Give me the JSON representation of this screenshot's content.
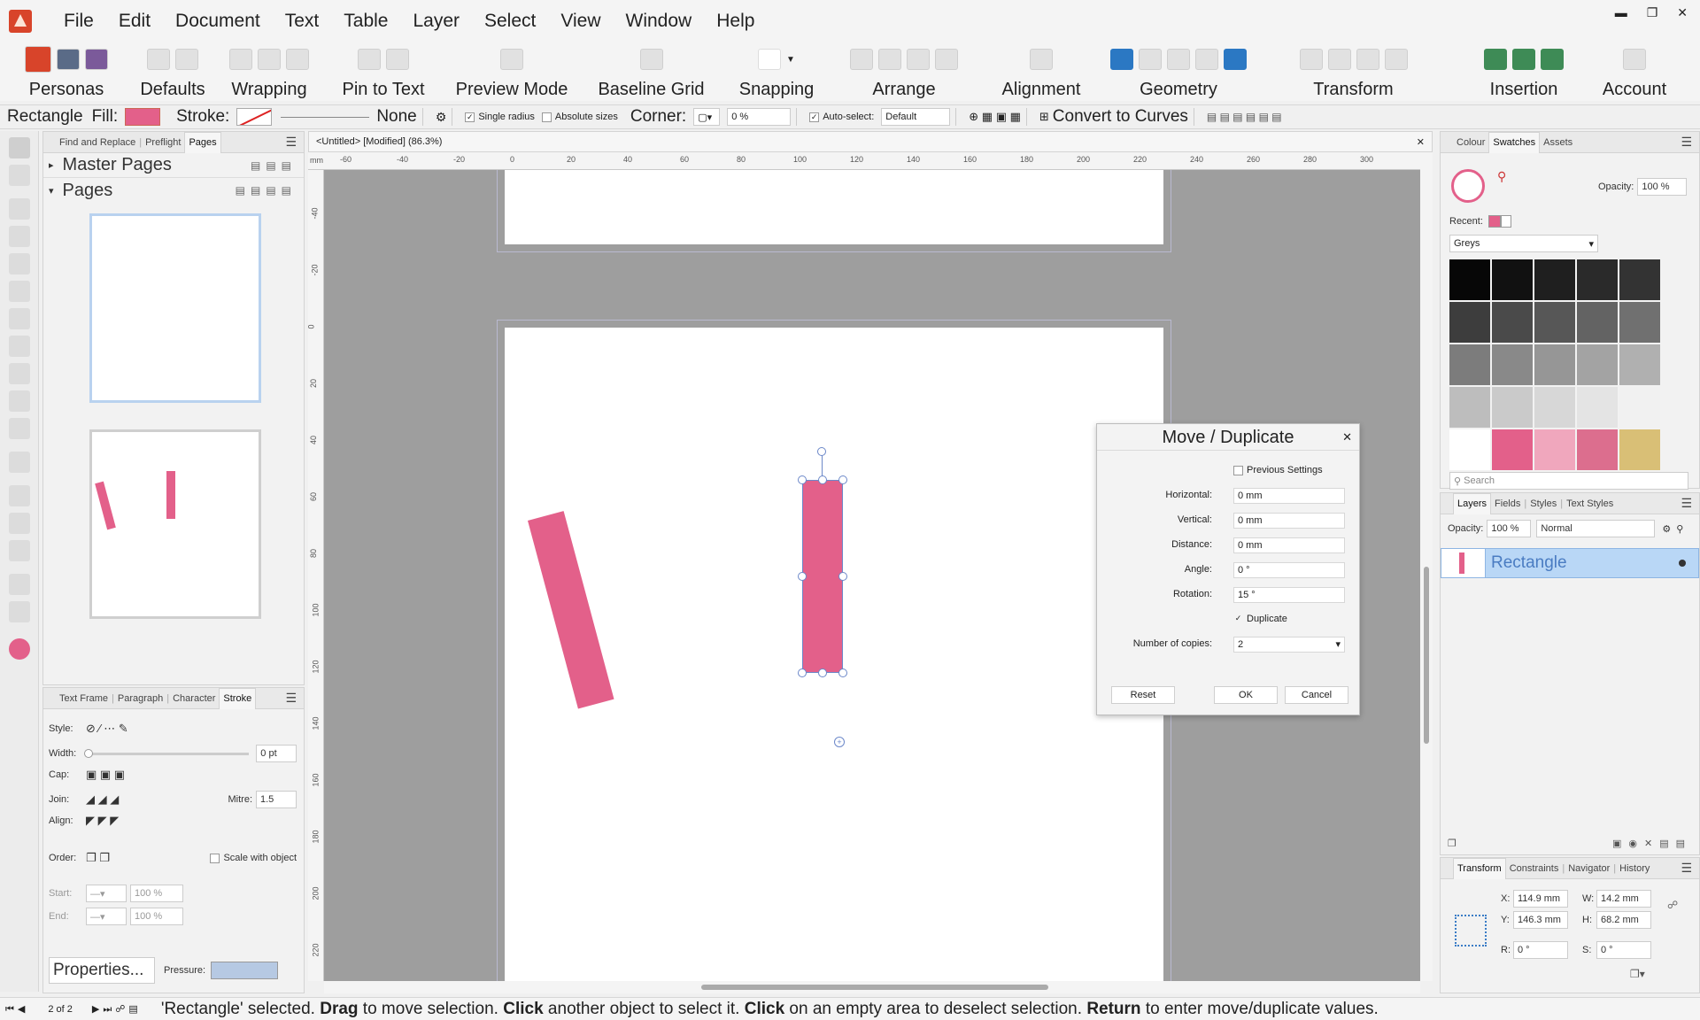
{
  "menubar": {
    "items": [
      "File",
      "Edit",
      "Document",
      "Text",
      "Table",
      "Layer",
      "Select",
      "View",
      "Window",
      "Help"
    ]
  },
  "toolbar": {
    "groups": [
      "Personas",
      "Defaults",
      "Wrapping",
      "Pin to Text",
      "Preview Mode",
      "Baseline Grid",
      "Snapping",
      "Arrange",
      "Alignment",
      "Geometry",
      "Transform",
      "Insertion",
      "Account"
    ]
  },
  "context": {
    "object": "Rectangle",
    "fill_label": "Fill:",
    "stroke_label": "Stroke:",
    "stroke_value": "None",
    "single_radius": "Single radius",
    "absolute_sizes": "Absolute sizes",
    "corner_label": "Corner:",
    "corner_value": "0 %",
    "auto_select_label": "Auto-select:",
    "auto_select_value": "Default",
    "convert": "Convert to Curves",
    "fill_color": "#e3608a"
  },
  "left_panel": {
    "tabs": [
      "Find and Replace",
      "Preflight",
      "Pages"
    ],
    "master_pages": "Master Pages",
    "pages": "Pages"
  },
  "stroke_panel": {
    "tabs": [
      "Text Frame",
      "Paragraph",
      "Character",
      "Stroke"
    ],
    "style": "Style:",
    "width": "Width:",
    "width_value": "0 pt",
    "cap": "Cap:",
    "join": "Join:",
    "mitre": "Mitre:",
    "mitre_value": "1.5",
    "align": "Align:",
    "order": "Order:",
    "scale": "Scale with object",
    "start": "Start:",
    "end": "End:",
    "pct": "100 %",
    "properties": "Properties...",
    "pressure": "Pressure:"
  },
  "document": {
    "tab_title": "<Untitled> [Modified] (86.3%)"
  },
  "ruler": {
    "h": [
      "-60",
      "-40",
      "-20",
      "0",
      "20",
      "40",
      "60",
      "80",
      "100",
      "120",
      "140",
      "160",
      "180",
      "200",
      "220",
      "240",
      "260",
      "280",
      "300"
    ],
    "v": [
      "-40",
      "-20",
      "0",
      "20",
      "40",
      "60",
      "80",
      "100",
      "120",
      "140",
      "160",
      "180",
      "200",
      "220"
    ],
    "unit": "mm"
  },
  "dialog": {
    "title": "Move / Duplicate",
    "previous": "Previous Settings",
    "horizontal_label": "Horizontal:",
    "horizontal": "0 mm",
    "vertical_label": "Vertical:",
    "vertical": "0 mm",
    "distance_label": "Distance:",
    "distance": "0 mm",
    "angle_label": "Angle:",
    "angle": "0 °",
    "rotation_label": "Rotation:",
    "rotation": "15 °",
    "duplicate": "Duplicate",
    "copies_label": "Number of copies:",
    "copies": "2",
    "reset": "Reset",
    "ok": "OK",
    "cancel": "Cancel"
  },
  "right_top": {
    "tabs": [
      "Colour",
      "Swatches",
      "Assets"
    ],
    "opacity_label": "Opacity:",
    "opacity": "100 %",
    "recent": "Recent:",
    "palette": "Greys",
    "search": "Search",
    "swatches": [
      "#070707",
      "#111111",
      "#1f1f1f",
      "#2a2a2a",
      "#333333",
      "#3d3d3d",
      "#4a4a4a",
      "#575757",
      "#636363",
      "#707070",
      "#7c7c7c",
      "#898989",
      "#969696",
      "#a3a3a3",
      "#b0b0b0",
      "#bdbdbd",
      "#cacaca",
      "#d7d7d7",
      "#e4e4e4",
      "#f1f1f1",
      "#ffffff",
      "#e3608a",
      "#f0a7bd",
      "#dc6e8e",
      "#d9bf76"
    ]
  },
  "layers": {
    "tabs": [
      "Layers",
      "Fields",
      "Styles",
      "Text Styles"
    ],
    "opacity_label": "Opacity:",
    "opacity": "100 %",
    "blend": "Normal",
    "item": "Rectangle"
  },
  "transform": {
    "tabs": [
      "Transform",
      "Constraints",
      "Navigator",
      "History"
    ],
    "x_label": "X:",
    "x": "114.9 mm",
    "y_label": "Y:",
    "y": "146.3 mm",
    "w_label": "W:",
    "w": "14.2 mm",
    "h_label": "H:",
    "h": "68.2 mm",
    "r_label": "R:",
    "r": "0 °",
    "s_label": "S:",
    "s": "0 °"
  },
  "status": {
    "page": "2 of 2",
    "msg_1": "'Rectangle' selected. ",
    "drag": "Drag",
    "msg_2": " to move selection. ",
    "click1": "Click",
    "msg_3": " another object to select it. ",
    "click2": "Click",
    "msg_4": " on an empty area to deselect selection. ",
    "return": "Return",
    "msg_5": " to enter move/duplicate values."
  }
}
